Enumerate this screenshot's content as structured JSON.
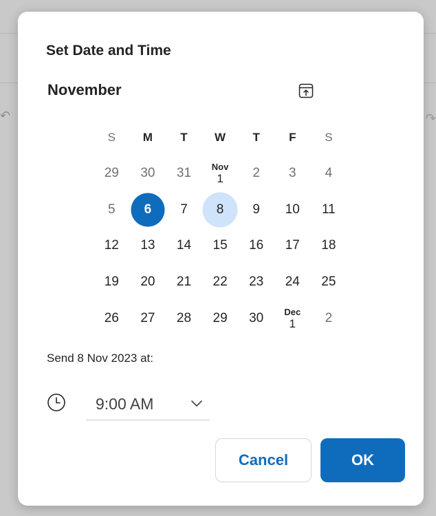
{
  "dialog": {
    "title": "Set Date and Time"
  },
  "calendar": {
    "month_label": "November",
    "nav_icon": "calendar-jump-icon",
    "weekdays": [
      "S",
      "M",
      "T",
      "W",
      "T",
      "F",
      "S"
    ],
    "weeks": [
      [
        {
          "text": "29",
          "muted": true
        },
        {
          "text": "30",
          "muted": true
        },
        {
          "text": "31",
          "muted": true
        },
        {
          "text": "1",
          "month_marker": "Nov"
        },
        {
          "text": "2",
          "muted": true
        },
        {
          "text": "3",
          "muted": true
        },
        {
          "text": "4",
          "muted": true
        }
      ],
      [
        {
          "text": "5",
          "muted": true
        },
        {
          "text": "6",
          "today": true
        },
        {
          "text": "7"
        },
        {
          "text": "8",
          "selected": true
        },
        {
          "text": "9"
        },
        {
          "text": "10"
        },
        {
          "text": "11"
        }
      ],
      [
        {
          "text": "12"
        },
        {
          "text": "13"
        },
        {
          "text": "14"
        },
        {
          "text": "15"
        },
        {
          "text": "16"
        },
        {
          "text": "17"
        },
        {
          "text": "18"
        }
      ],
      [
        {
          "text": "19"
        },
        {
          "text": "20"
        },
        {
          "text": "21"
        },
        {
          "text": "22"
        },
        {
          "text": "23"
        },
        {
          "text": "24"
        },
        {
          "text": "25"
        }
      ],
      [
        {
          "text": "26"
        },
        {
          "text": "27"
        },
        {
          "text": "28"
        },
        {
          "text": "29"
        },
        {
          "text": "30"
        },
        {
          "text": "1",
          "month_marker": "Dec"
        },
        {
          "text": "2",
          "muted": true
        }
      ]
    ]
  },
  "send": {
    "label": "Send 8 Nov 2023 at:"
  },
  "time": {
    "icon": "clock-icon",
    "value": "9:00 AM",
    "dropdown_icon": "chevron-down-icon"
  },
  "buttons": {
    "cancel_label": "Cancel",
    "ok_label": "OK"
  },
  "colors": {
    "accent": "#0f6cbd",
    "selected_bg": "#cfe4fa",
    "overlay": "#c9c9c9"
  }
}
